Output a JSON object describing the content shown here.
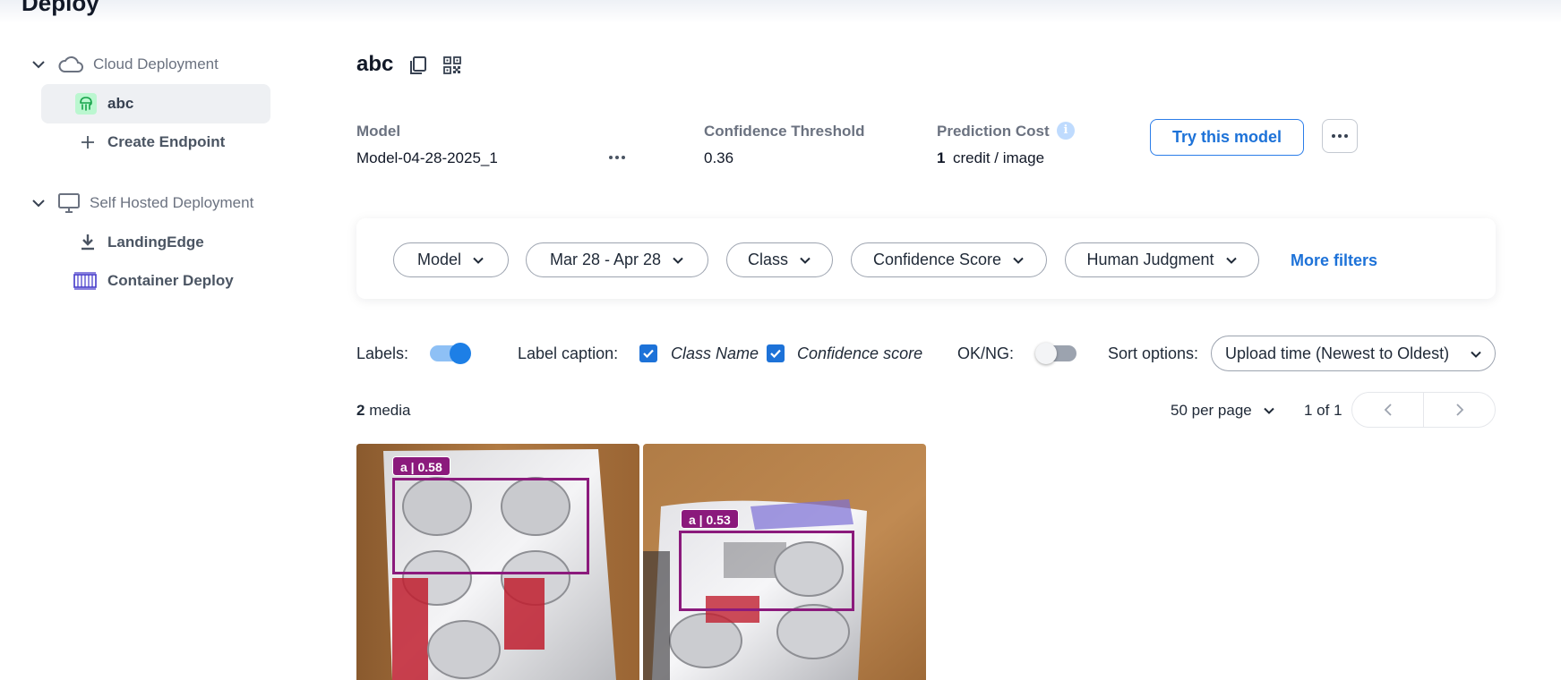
{
  "page": {
    "title": "Deploy"
  },
  "sidebar": {
    "cloud_group": {
      "label": "Cloud Deployment"
    },
    "cloud_items": [
      {
        "label": "abc"
      },
      {
        "label": "Create Endpoint"
      }
    ],
    "self_hosted_group": {
      "label": "Self Hosted Deployment"
    },
    "self_hosted_items": [
      {
        "label": "LandingEdge"
      },
      {
        "label": "Container Deploy"
      }
    ]
  },
  "endpoint": {
    "name": "abc",
    "model_label": "Model",
    "model_value": "Model-04-28-2025_1",
    "threshold_label": "Confidence Threshold",
    "threshold_value": "0.36",
    "cost_label": "Prediction Cost",
    "cost_amount": "1",
    "cost_unit": "credit / image",
    "try_button": "Try this model"
  },
  "filters": {
    "model": "Model",
    "date_range": "Mar 28 - Apr 28",
    "class": "Class",
    "confidence": "Confidence Score",
    "human_judgment": "Human Judgment",
    "more": "More filters"
  },
  "controls": {
    "labels_label": "Labels:",
    "labels_on": true,
    "caption_label": "Label caption:",
    "class_name": "Class Name",
    "class_name_checked": true,
    "confidence_score": "Confidence score",
    "confidence_score_checked": true,
    "okng_label": "OK/NG:",
    "okng_on": false,
    "sort_label": "Sort options:",
    "sort_value": "Upload time (Newest to Oldest)"
  },
  "media": {
    "count": "2",
    "count_suffix": " media",
    "per_page": "50 per page",
    "page_info": "1 of 1",
    "items": [
      {
        "tag": "a | 0.58"
      },
      {
        "tag": "a | 0.53"
      }
    ]
  },
  "colors": {
    "accent": "#1d72d8",
    "bbox": "#8b1a7c",
    "sidebar_active": "#eef0f3"
  }
}
